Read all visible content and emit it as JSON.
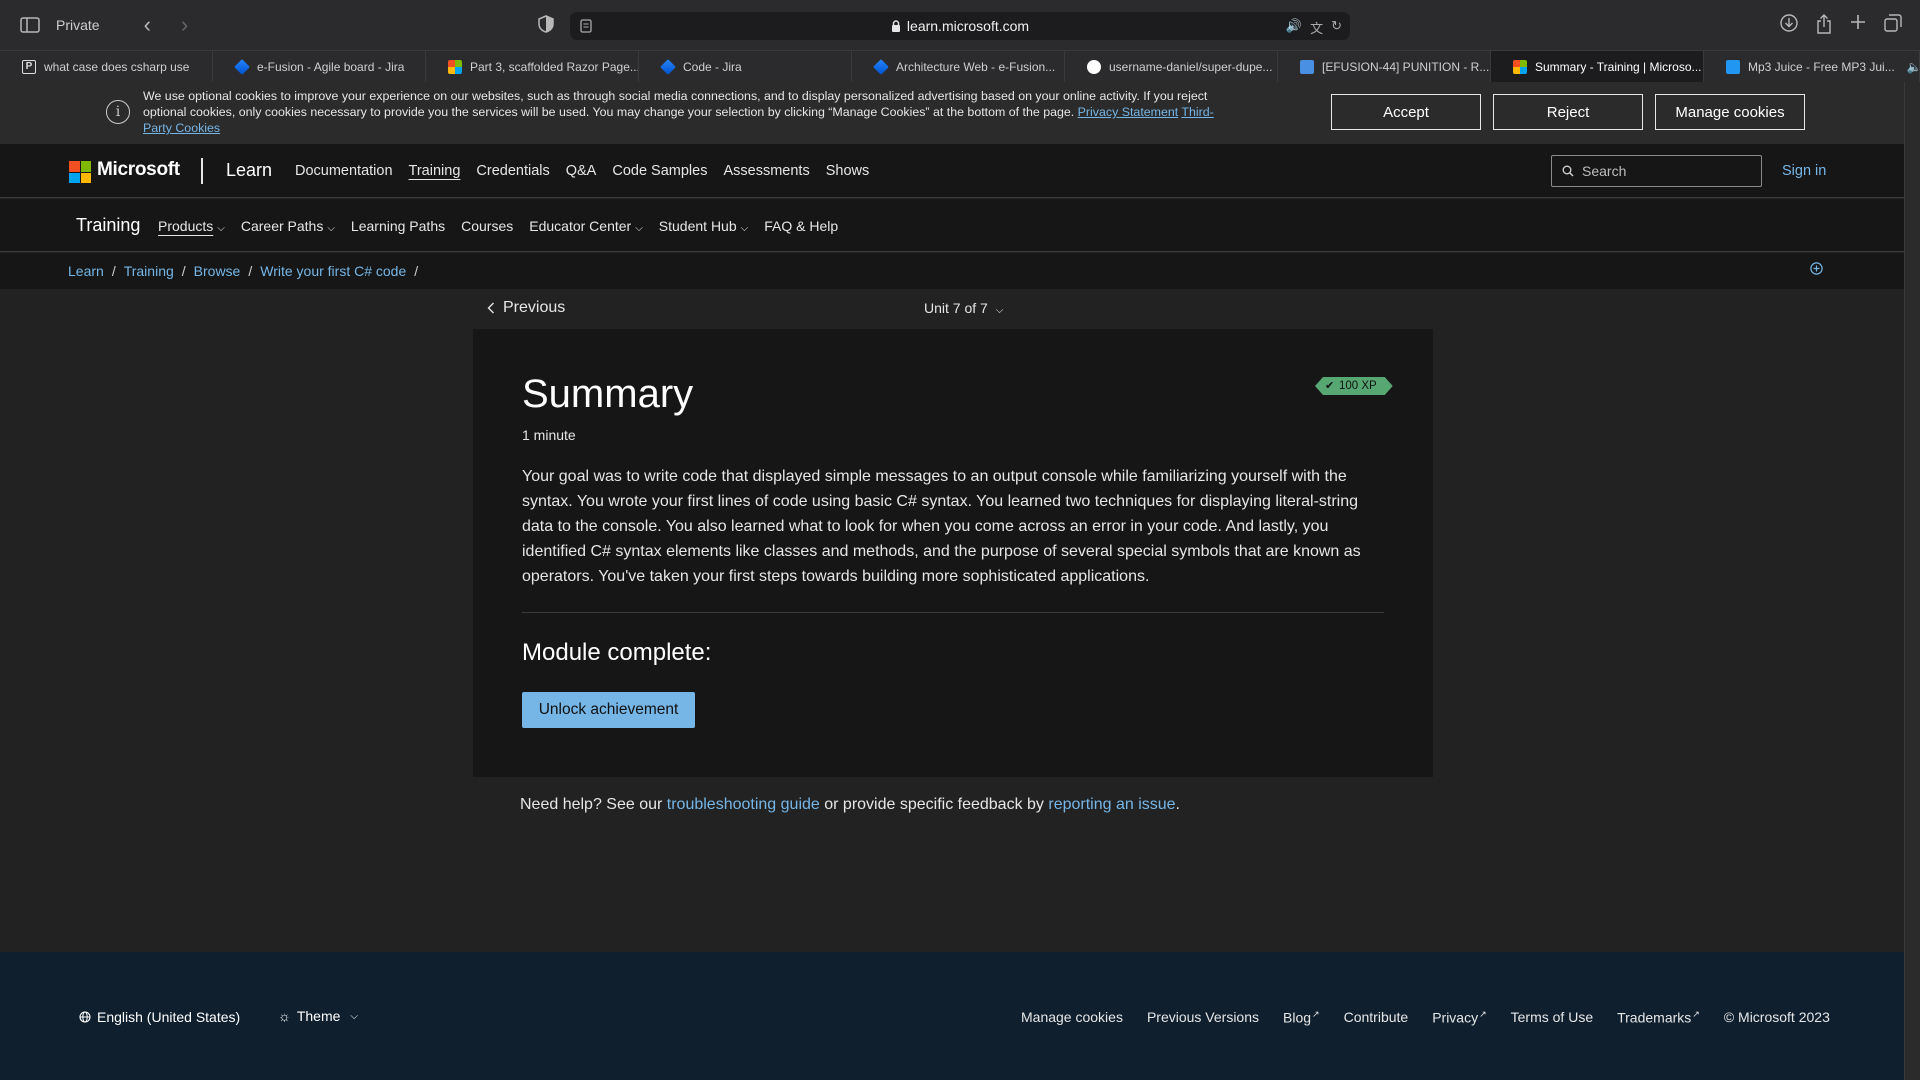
{
  "browser": {
    "private_label": "Private",
    "url": "learn.microsoft.com",
    "tabs": [
      {
        "label": "what case does csharp use",
        "favicon": "p-icon"
      },
      {
        "label": "e-Fusion - Agile board - Jira",
        "favicon": "jira-icon"
      },
      {
        "label": "Part 3, scaffolded Razor Page...",
        "favicon": "microsoft-icon"
      },
      {
        "label": "Code - Jira",
        "favicon": "jira-icon"
      },
      {
        "label": "Architecture Web - e-Fusion...",
        "favicon": "jira-icon"
      },
      {
        "label": "username-daniel/super-dupe...",
        "favicon": "github-icon"
      },
      {
        "label": "[EFUSION-44] PUNITION - R...",
        "favicon": "app-icon"
      },
      {
        "label": "Summary - Training | Microso...",
        "favicon": "microsoft-icon",
        "active": true
      },
      {
        "label": "Mp3 Juice - Free MP3 Jui...",
        "favicon": "download-icon"
      }
    ]
  },
  "cookie_banner": {
    "text": "We use optional cookies to improve your experience on our websites, such as through social media connections, and to display personalized advertising based on your online activity. If you reject optional cookies, only cookies necessary to provide you the services will be used. You may change your selection by clicking “Manage Cookies” at the bottom of the page.",
    "privacy_link": "Privacy Statement",
    "third_party_link": "Third-Party Cookies",
    "accept": "Accept",
    "reject": "Reject",
    "manage": "Manage cookies"
  },
  "header": {
    "brand": "Microsoft",
    "product": "Learn",
    "nav": [
      "Documentation",
      "Training",
      "Credentials",
      "Q&A",
      "Code Samples",
      "Assessments",
      "Shows"
    ],
    "active_nav": "Training",
    "search_placeholder": "Search",
    "sign_in": "Sign in"
  },
  "subnav": {
    "title": "Training",
    "items": [
      {
        "label": "Products",
        "dropdown": true,
        "active": true
      },
      {
        "label": "Career Paths",
        "dropdown": true
      },
      {
        "label": "Learning Paths",
        "dropdown": false
      },
      {
        "label": "Courses",
        "dropdown": false
      },
      {
        "label": "Educator Center",
        "dropdown": true
      },
      {
        "label": "Student Hub",
        "dropdown": true
      },
      {
        "label": "FAQ & Help",
        "dropdown": false
      }
    ]
  },
  "breadcrumb": [
    "Learn",
    "Training",
    "Browse",
    "Write your first C# code"
  ],
  "unit_nav": {
    "previous": "Previous",
    "unit": "Unit 7 of 7"
  },
  "content": {
    "title": "Summary",
    "xp": "100 XP",
    "duration": "1 minute",
    "body": "Your goal was to write code that displayed simple messages to an output console while familiarizing yourself with the syntax. You wrote your first lines of code using basic C# syntax. You learned two techniques for displaying literal-string data to the console. You also learned what to look for when you come across an error in your code. And lastly, you identified C# syntax elements like classes and methods, and the purpose of several special symbols that are known as operators. You've taken your first steps towards building more sophisticated applications.",
    "module_complete": "Module complete:",
    "unlock_button": "Unlock achievement"
  },
  "help": {
    "prefix": "Need help? See our ",
    "guide_link": "troubleshooting guide",
    "middle": " or provide specific feedback by ",
    "issue_link": "reporting an issue",
    "suffix": "."
  },
  "footer": {
    "language": "English (United States)",
    "theme": "Theme",
    "links": [
      {
        "label": "Manage cookies",
        "external": false
      },
      {
        "label": "Previous Versions",
        "external": false
      },
      {
        "label": "Blog",
        "external": true
      },
      {
        "label": "Contribute",
        "external": false
      },
      {
        "label": "Privacy",
        "external": true
      },
      {
        "label": "Terms of Use",
        "external": false
      },
      {
        "label": "Trademarks",
        "external": true
      },
      {
        "label": "© Microsoft 2023",
        "external": false
      }
    ]
  },
  "colors": {
    "link": "#75b6e7",
    "xp_badge": "#57a773",
    "footer_bg": "#0f1f2e",
    "card_bg": "#161616"
  }
}
